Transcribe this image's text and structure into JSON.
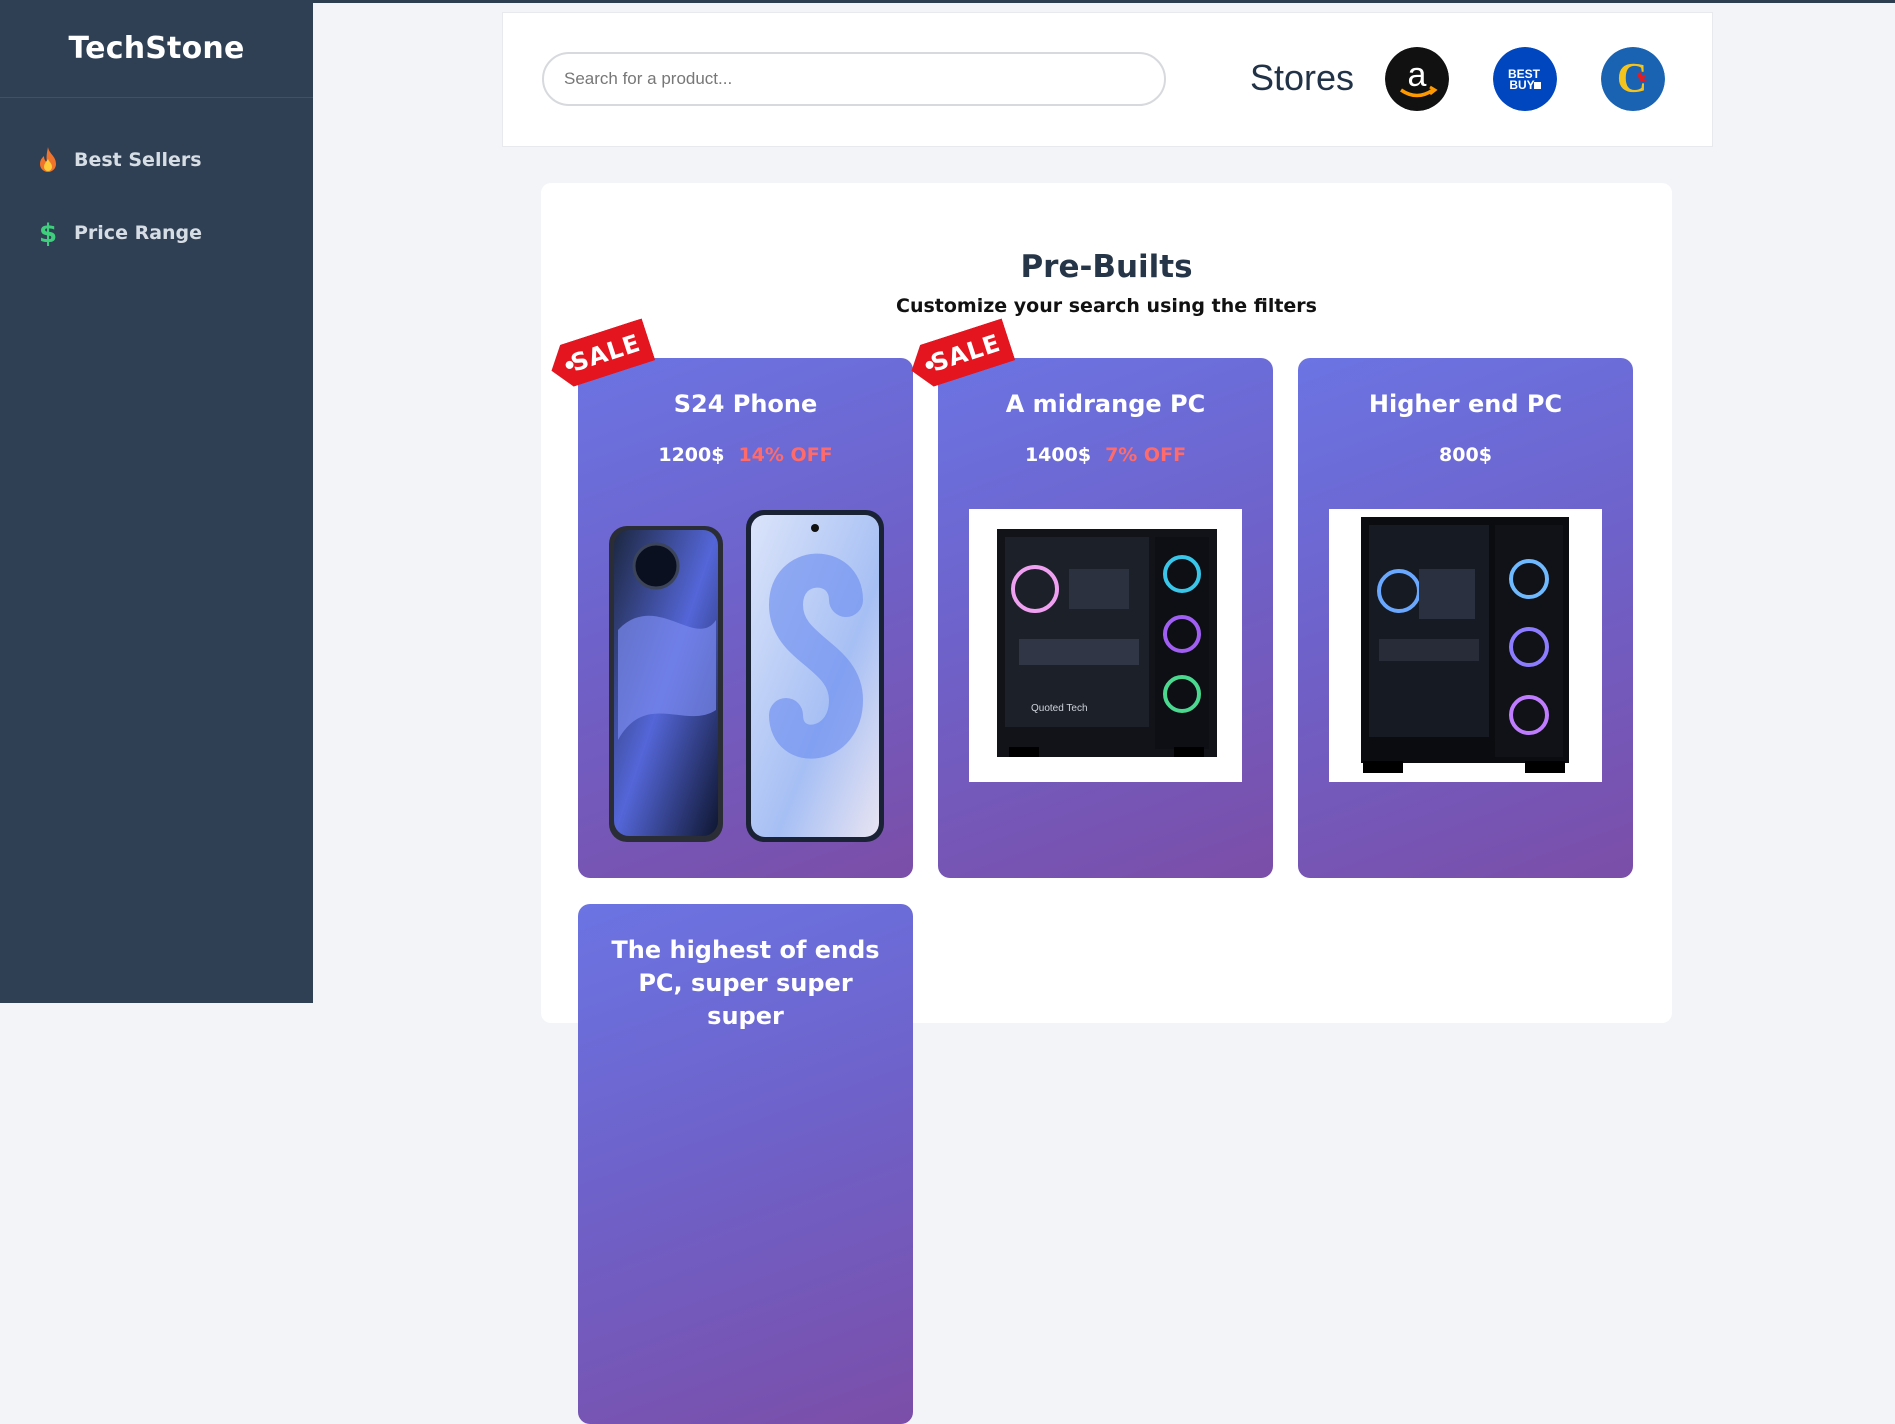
{
  "app": {
    "brand": "TechStone"
  },
  "sidebar": {
    "items": [
      {
        "label": "Best Sellers",
        "icon": "fire-icon"
      },
      {
        "label": "Price Range",
        "icon": "dollar-icon"
      }
    ]
  },
  "header": {
    "search_placeholder": "Search for a product...",
    "stores_label": "Stores",
    "stores": [
      {
        "name": "amazon",
        "icon": "amazon-logo-icon",
        "color": "#111111"
      },
      {
        "name": "best buy",
        "icon": "bestbuy-logo-icon",
        "color": "#0046be"
      },
      {
        "name": "canada computers",
        "icon": "canada-computers-logo-icon",
        "color": "#1a63b3"
      }
    ]
  },
  "main": {
    "title": "Pre-Builts",
    "subtitle": "Customize your search using the filters",
    "sale_label": "SALE",
    "products": [
      {
        "name": "S24 Phone",
        "price": "1200$",
        "discount": "14% OFF",
        "sale": true
      },
      {
        "name": "A midrange PC",
        "price": "1400$",
        "discount": "7% OFF",
        "sale": true
      },
      {
        "name": "Higher end PC",
        "price": "800$",
        "discount": "",
        "sale": false
      },
      {
        "name": "The highest of ends PC, super super super",
        "price": "",
        "discount": "",
        "sale": false
      }
    ]
  }
}
